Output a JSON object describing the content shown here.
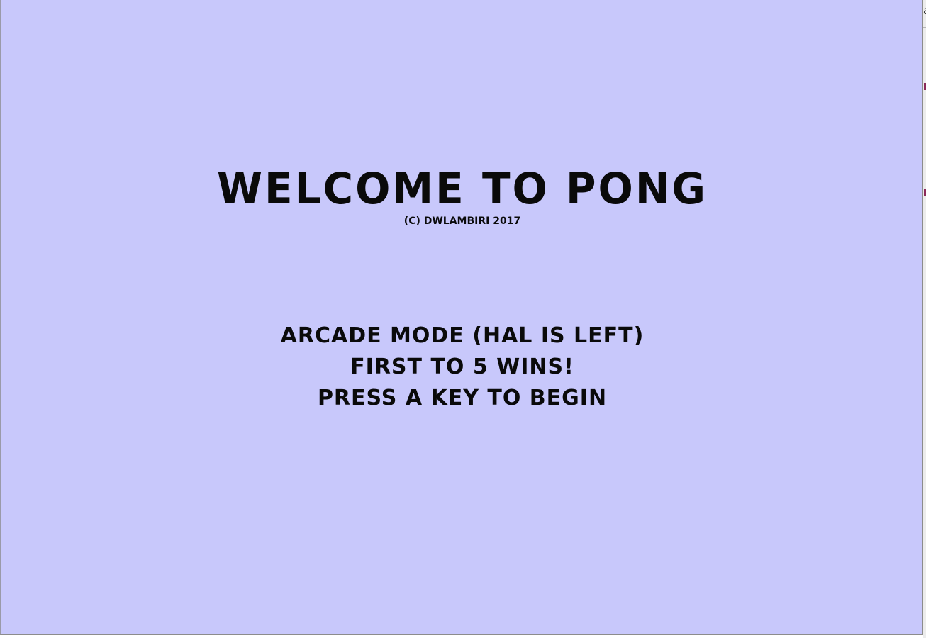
{
  "game": {
    "title": "WELCOME TO PONG",
    "copyright": "(C) DWLAMBIRI 2017",
    "lines": [
      "ARCADE MODE (HAL IS LEFT)",
      "FIRST TO 5 WINS!",
      "PRESS A KEY TO BEGIN"
    ]
  },
  "side_strip": {
    "visible_char": "a"
  },
  "colors": {
    "background": "#c8c8fb",
    "text": "#0a0a0a",
    "side_mark": "#8b2a5a"
  }
}
